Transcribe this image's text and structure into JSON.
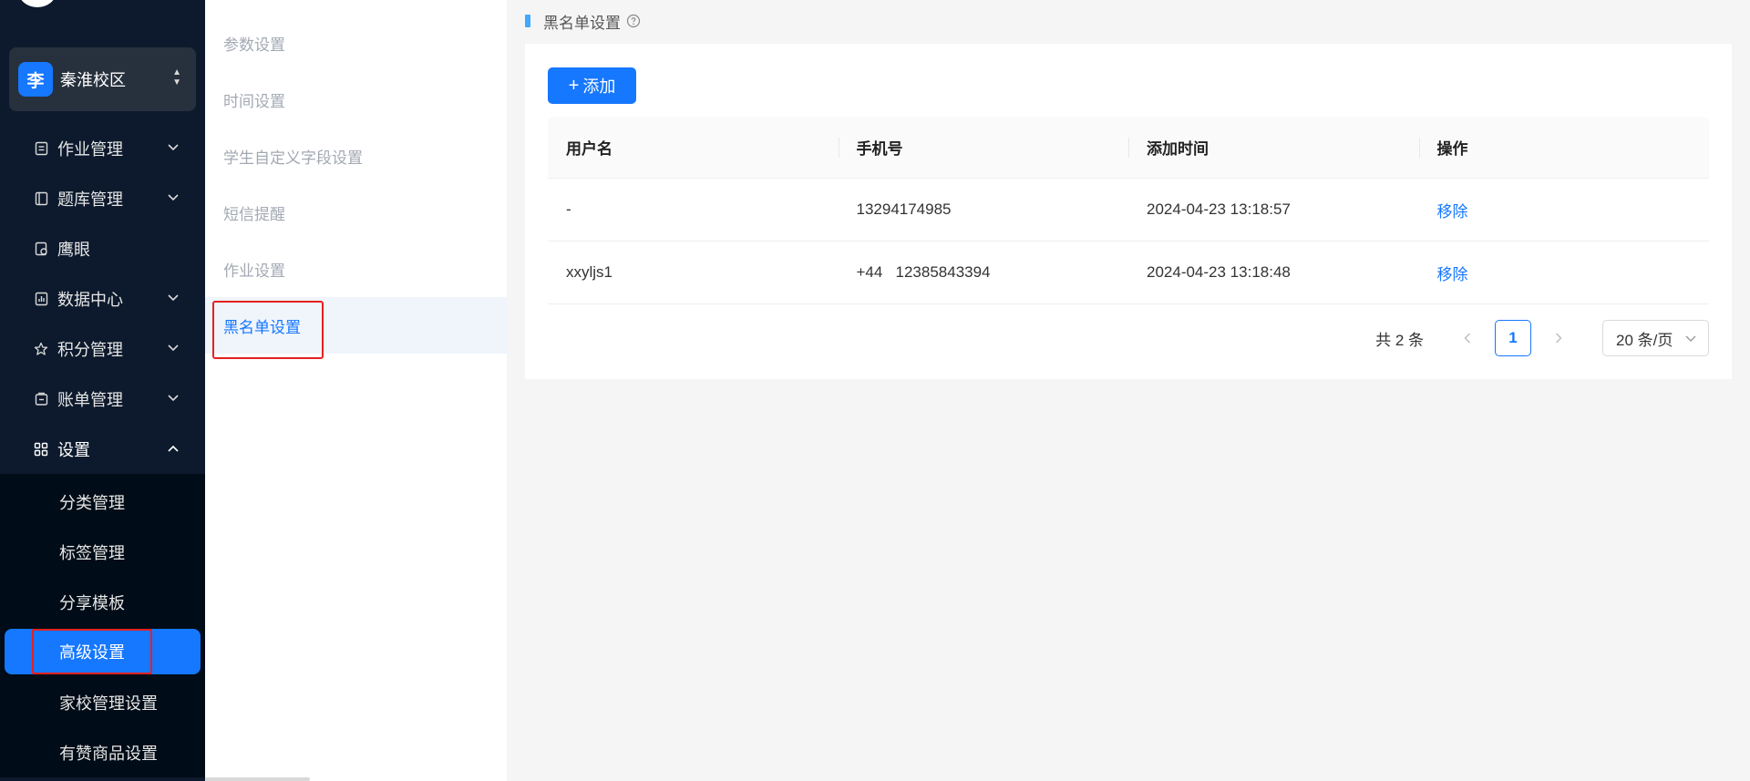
{
  "campus": {
    "avatar": "李",
    "name": "秦淮校区"
  },
  "menu": [
    {
      "label": "作业管理",
      "icon": "document-icon",
      "chevron": "down"
    },
    {
      "label": "题库管理",
      "icon": "book-icon",
      "chevron": "down"
    },
    {
      "label": "鹰眼",
      "icon": "eye-icon",
      "chevron": ""
    },
    {
      "label": "数据中心",
      "icon": "chart-icon",
      "chevron": "down"
    },
    {
      "label": "积分管理",
      "icon": "star-icon",
      "chevron": "down"
    },
    {
      "label": "账单管理",
      "icon": "bill-icon",
      "chevron": "down"
    },
    {
      "label": "设置",
      "icon": "grid-icon",
      "chevron": "up"
    }
  ],
  "settings_submenu": [
    "分类管理",
    "标签管理",
    "分享模板",
    "高级设置",
    "家校管理设置",
    "有赞商品设置"
  ],
  "settings_submenu_active": "高级设置",
  "subnav": [
    "参数设置",
    "时间设置",
    "学生自定义字段设置",
    "短信提醒",
    "作业设置",
    "黑名单设置"
  ],
  "subnav_active": "黑名单设置",
  "page": {
    "title": "黑名单设置"
  },
  "toolbar": {
    "add_label": "添加",
    "add_plus": "+"
  },
  "table": {
    "headers": [
      "用户名",
      "手机号",
      "添加时间",
      "操作"
    ],
    "rows": [
      {
        "username": "-",
        "phone": "13294174985",
        "added_at": "2024-04-23 13:18:57",
        "action": "移除"
      },
      {
        "username": "xxyljs1",
        "phone": "+44   12385843394",
        "added_at": "2024-04-23 13:18:48",
        "action": "移除"
      }
    ]
  },
  "pagination": {
    "total": "共 2 条",
    "current_page": "1",
    "page_size": "20 条/页"
  },
  "colors": {
    "accent": "#1677ff",
    "sidebar_bg": "#0d1a2d",
    "highlight_box": "#e62020"
  }
}
